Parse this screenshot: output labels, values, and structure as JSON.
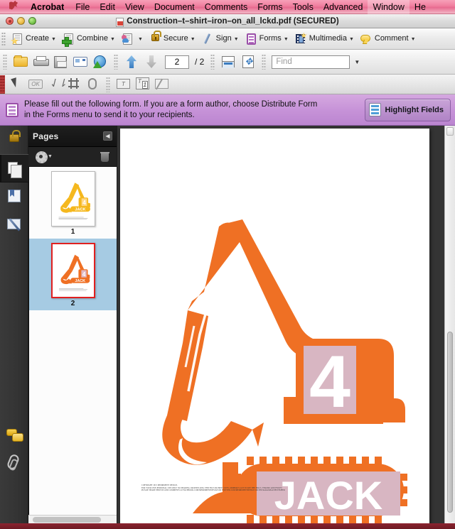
{
  "menubar": {
    "apple_icon": "apple-logo-icon",
    "items": [
      {
        "label": "Acrobat",
        "bold": true
      },
      {
        "label": "File",
        "bold": false
      },
      {
        "label": "Edit",
        "bold": false
      },
      {
        "label": "View",
        "bold": false
      },
      {
        "label": "Document",
        "bold": false
      },
      {
        "label": "Comments",
        "bold": false
      },
      {
        "label": "Forms",
        "bold": false
      },
      {
        "label": "Tools",
        "bold": false
      },
      {
        "label": "Advanced",
        "bold": false
      },
      {
        "label": "Window",
        "bold": false
      },
      {
        "label": "He",
        "bold": false
      }
    ]
  },
  "window": {
    "title": "Construction–t–shirt–iron–on_all_lckd.pdf (SECURED)",
    "close_label": "",
    "minimize_label": "",
    "zoom_label": ""
  },
  "toolbar_main": {
    "buttons": [
      {
        "label": "Create",
        "icon": "create-document-icon",
        "has_caret": true
      },
      {
        "label": "Combine",
        "icon": "combine-files-icon",
        "has_caret": true
      },
      {
        "label": "",
        "icon": "collaborate-icon",
        "has_caret": true
      },
      {
        "label": "Secure",
        "icon": "lock-icon",
        "has_caret": true
      },
      {
        "label": "Sign",
        "icon": "pen-icon",
        "has_caret": true
      },
      {
        "label": "Forms",
        "icon": "forms-icon",
        "has_caret": true
      },
      {
        "label": "Multimedia",
        "icon": "film-icon",
        "has_caret": true
      },
      {
        "label": "Comment",
        "icon": "speech-bubble-icon",
        "has_caret": true
      }
    ]
  },
  "toolbar_file": {
    "open_icon": "open-folder-icon",
    "print_icon": "print-icon",
    "save_icon": "save-icon",
    "email_icon": "email-icon",
    "upload_icon": "upload-globe-icon",
    "prev_page_icon": "arrow-up-icon",
    "next_page_icon": "arrow-down-icon",
    "page_current": "2",
    "page_total": "/ 2",
    "fit_width_icon": "fit-width-icon",
    "fit_page_icon": "fit-page-icon",
    "find_placeholder": "Find",
    "find_value": "",
    "find_caret_icon": "chevron-down-icon"
  },
  "toolbar_forms": {
    "buttons": [
      {
        "icon": "select-cursor-icon",
        "label": ""
      },
      {
        "icon": "button-field-icon",
        "label": "OK"
      },
      {
        "icon": "dropdown-field-icon",
        "label": ""
      },
      {
        "icon": "listbox-field-icon",
        "label": ""
      },
      {
        "icon": "link-field-icon",
        "label": ""
      },
      {
        "icon": "text-field-icon",
        "label": "T"
      },
      {
        "icon": "numbered-field-icon",
        "label": "T"
      },
      {
        "icon": "edit-field-icon",
        "label": ""
      }
    ],
    "numbered_badge": "1"
  },
  "notice_bar": {
    "icon": "form-document-icon",
    "line1": "Please fill out the following form. If you are a form author, choose Distribute Form",
    "line2": "in the Forms menu to send it to your recipients.",
    "highlight_button_label": "Highlight Fields",
    "highlight_button_icon": "highlight-fields-icon",
    "background_color": "#c793d8"
  },
  "nav_rail": {
    "items": [
      {
        "name": "security-panel",
        "icon": "lock-icon",
        "selected": false
      },
      {
        "name": "pages-panel",
        "icon": "pages-icon",
        "selected": true
      },
      {
        "name": "bookmarks-panel",
        "icon": "bookmarks-icon",
        "selected": false
      },
      {
        "name": "signatures-panel",
        "icon": "signatures-icon",
        "selected": false
      }
    ],
    "bottom_items": [
      {
        "name": "comments-panel",
        "icon": "comments-icon"
      },
      {
        "name": "attachments-panel",
        "icon": "paperclip-icon"
      }
    ]
  },
  "pages_panel": {
    "title": "Pages",
    "collapse_icon": "chevron-left-icon",
    "options_icon": "gear-icon",
    "options_caret_icon": "chevron-down-icon",
    "delete_icon": "trash-icon",
    "thumbnails": [
      {
        "number": "1",
        "selected": false,
        "color": "#f5b81e"
      },
      {
        "number": "2",
        "selected": true,
        "color": "#ef7024"
      }
    ]
  },
  "document": {
    "graphic_name": "excavator-illustration",
    "machine_color": "#ef7024",
    "field_fill_color": "#d8b6c2",
    "number_field_value": "4",
    "name_field_value": "JACK",
    "copyright_lines": [
      "COPYRIGHT 2015 MERRIMENT DESIGN.",
      "FOR YOUR OWN PERSONAL USE ONLY. NO SHARING OR RESELLING THIS FILE OR PRINT OUTS, MOMMA'S GOT TO PAY THE BILLS. THANKS AND ENJOY!",
      "PLEASE SHARE PHOTOS AND COMMENTS AT FACEBOOK.COM/MERRIMENTDESIGN OR TWITTER.COM/MERRIMENTDESIGN OR INSTAGRAM/KATIESTEUBER"
    ]
  },
  "scrollbars": {
    "vertical_name": "document-vertical-scrollbar",
    "horizontal_name": "pages-horizontal-scrollbar"
  }
}
